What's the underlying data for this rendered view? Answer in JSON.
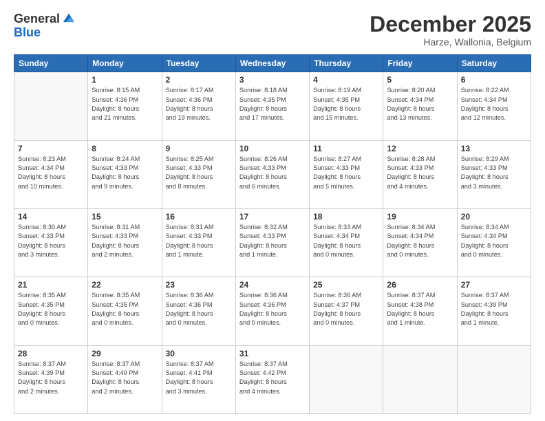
{
  "logo": {
    "general": "General",
    "blue": "Blue"
  },
  "header": {
    "month": "December 2025",
    "location": "Harze, Wallonia, Belgium"
  },
  "weekdays": [
    "Sunday",
    "Monday",
    "Tuesday",
    "Wednesday",
    "Thursday",
    "Friday",
    "Saturday"
  ],
  "weeks": [
    [
      {
        "day": "",
        "info": ""
      },
      {
        "day": "1",
        "info": "Sunrise: 8:15 AM\nSunset: 4:36 PM\nDaylight: 8 hours\nand 21 minutes."
      },
      {
        "day": "2",
        "info": "Sunrise: 8:17 AM\nSunset: 4:36 PM\nDaylight: 8 hours\nand 19 minutes."
      },
      {
        "day": "3",
        "info": "Sunrise: 8:18 AM\nSunset: 4:35 PM\nDaylight: 8 hours\nand 17 minutes."
      },
      {
        "day": "4",
        "info": "Sunrise: 8:19 AM\nSunset: 4:35 PM\nDaylight: 8 hours\nand 15 minutes."
      },
      {
        "day": "5",
        "info": "Sunrise: 8:20 AM\nSunset: 4:34 PM\nDaylight: 8 hours\nand 13 minutes."
      },
      {
        "day": "6",
        "info": "Sunrise: 8:22 AM\nSunset: 4:34 PM\nDaylight: 8 hours\nand 12 minutes."
      }
    ],
    [
      {
        "day": "7",
        "info": "Sunrise: 8:23 AM\nSunset: 4:34 PM\nDaylight: 8 hours\nand 10 minutes."
      },
      {
        "day": "8",
        "info": "Sunrise: 8:24 AM\nSunset: 4:33 PM\nDaylight: 8 hours\nand 9 minutes."
      },
      {
        "day": "9",
        "info": "Sunrise: 8:25 AM\nSunset: 4:33 PM\nDaylight: 8 hours\nand 8 minutes."
      },
      {
        "day": "10",
        "info": "Sunrise: 8:26 AM\nSunset: 4:33 PM\nDaylight: 8 hours\nand 6 minutes."
      },
      {
        "day": "11",
        "info": "Sunrise: 8:27 AM\nSunset: 4:33 PM\nDaylight: 8 hours\nand 5 minutes."
      },
      {
        "day": "12",
        "info": "Sunrise: 8:28 AM\nSunset: 4:33 PM\nDaylight: 8 hours\nand 4 minutes."
      },
      {
        "day": "13",
        "info": "Sunrise: 8:29 AM\nSunset: 4:33 PM\nDaylight: 8 hours\nand 3 minutes."
      }
    ],
    [
      {
        "day": "14",
        "info": "Sunrise: 8:30 AM\nSunset: 4:33 PM\nDaylight: 8 hours\nand 3 minutes."
      },
      {
        "day": "15",
        "info": "Sunrise: 8:31 AM\nSunset: 4:33 PM\nDaylight: 8 hours\nand 2 minutes."
      },
      {
        "day": "16",
        "info": "Sunrise: 8:31 AM\nSunset: 4:33 PM\nDaylight: 8 hours\nand 1 minute."
      },
      {
        "day": "17",
        "info": "Sunrise: 8:32 AM\nSunset: 4:33 PM\nDaylight: 8 hours\nand 1 minute."
      },
      {
        "day": "18",
        "info": "Sunrise: 8:33 AM\nSunset: 4:34 PM\nDaylight: 8 hours\nand 0 minutes."
      },
      {
        "day": "19",
        "info": "Sunrise: 8:34 AM\nSunset: 4:34 PM\nDaylight: 8 hours\nand 0 minutes."
      },
      {
        "day": "20",
        "info": "Sunrise: 8:34 AM\nSunset: 4:34 PM\nDaylight: 8 hours\nand 0 minutes."
      }
    ],
    [
      {
        "day": "21",
        "info": "Sunrise: 8:35 AM\nSunset: 4:35 PM\nDaylight: 8 hours\nand 0 minutes."
      },
      {
        "day": "22",
        "info": "Sunrise: 8:35 AM\nSunset: 4:35 PM\nDaylight: 8 hours\nand 0 minutes."
      },
      {
        "day": "23",
        "info": "Sunrise: 8:36 AM\nSunset: 4:36 PM\nDaylight: 8 hours\nand 0 minutes."
      },
      {
        "day": "24",
        "info": "Sunrise: 8:36 AM\nSunset: 4:36 PM\nDaylight: 8 hours\nand 0 minutes."
      },
      {
        "day": "25",
        "info": "Sunrise: 8:36 AM\nSunset: 4:37 PM\nDaylight: 8 hours\nand 0 minutes."
      },
      {
        "day": "26",
        "info": "Sunrise: 8:37 AM\nSunset: 4:38 PM\nDaylight: 8 hours\nand 1 minute."
      },
      {
        "day": "27",
        "info": "Sunrise: 8:37 AM\nSunset: 4:39 PM\nDaylight: 8 hours\nand 1 minute."
      }
    ],
    [
      {
        "day": "28",
        "info": "Sunrise: 8:37 AM\nSunset: 4:39 PM\nDaylight: 8 hours\nand 2 minutes."
      },
      {
        "day": "29",
        "info": "Sunrise: 8:37 AM\nSunset: 4:40 PM\nDaylight: 8 hours\nand 2 minutes."
      },
      {
        "day": "30",
        "info": "Sunrise: 8:37 AM\nSunset: 4:41 PM\nDaylight: 8 hours\nand 3 minutes."
      },
      {
        "day": "31",
        "info": "Sunrise: 8:37 AM\nSunset: 4:42 PM\nDaylight: 8 hours\nand 4 minutes."
      },
      {
        "day": "",
        "info": ""
      },
      {
        "day": "",
        "info": ""
      },
      {
        "day": "",
        "info": ""
      }
    ]
  ]
}
